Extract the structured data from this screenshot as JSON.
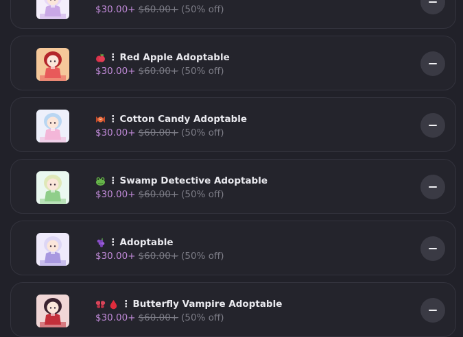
{
  "cart": {
    "items": [
      {
        "title": "",
        "emoji_icons": [],
        "sale_price": "$30.00+",
        "original_price": "$60.00+",
        "discount": "(50% off)",
        "thumb_colors": {
          "bg": "#f4eefb",
          "accent": "#c9a7e6",
          "hair": "#e8d8f8"
        }
      },
      {
        "title": "Red Apple Adoptable",
        "emoji_icons": [
          "apple-icon"
        ],
        "sale_price": "$30.00+",
        "original_price": "$60.00+",
        "discount": "(50% off)",
        "thumb_colors": {
          "bg": "#f5c89a",
          "accent": "#e85a5a",
          "hair": "#b3262b"
        }
      },
      {
        "title": "Cotton Candy Adoptable",
        "emoji_icons": [
          "candy-icon"
        ],
        "sale_price": "$30.00+",
        "original_price": "$60.00+",
        "discount": "(50% off)",
        "thumb_colors": {
          "bg": "#eef0fb",
          "accent": "#f3b6d8",
          "hair": "#b9d6f2"
        }
      },
      {
        "title": "Swamp Detective Adoptable",
        "emoji_icons": [
          "frog-icon"
        ],
        "sale_price": "$30.00+",
        "original_price": "$60.00+",
        "discount": "(50% off)",
        "thumb_colors": {
          "bg": "#eaf8f0",
          "accent": "#8fce8a",
          "hair": "#dfe8b8"
        }
      },
      {
        "title": "Adoptable",
        "emoji_icons": [
          "grapes-icon"
        ],
        "sale_price": "$30.00+",
        "original_price": "$60.00+",
        "discount": "(50% off)",
        "thumb_colors": {
          "bg": "#efeafb",
          "accent": "#a898e0",
          "hair": "#ddd6f5"
        }
      },
      {
        "title": "Butterfly Vampire Adoptable",
        "emoji_icons": [
          "butterfly-icon",
          "blood-drop-icon"
        ],
        "sale_price": "$30.00+",
        "original_price": "$60.00+",
        "discount": "(50% off)",
        "thumb_colors": {
          "bg": "#f0d6d6",
          "accent": "#c22f3a",
          "hair": "#3b2330"
        }
      }
    ]
  },
  "colors": {
    "background": "#212129",
    "card": "#24242c",
    "sale_price": "#c08ad8",
    "muted": "#7c7c86",
    "remove_button": "#3a3a44"
  }
}
